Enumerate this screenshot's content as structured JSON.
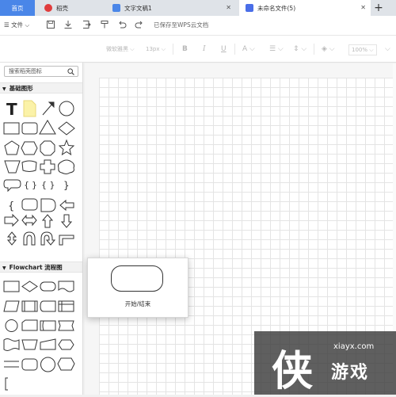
{
  "tabs": [
    {
      "label": "首页",
      "color": "#4a86e8"
    },
    {
      "label": "稻壳",
      "icon": "docer-icon",
      "color": "#e03c3c"
    },
    {
      "label": "文字文稿1",
      "icon": "word-doc-icon",
      "color": "#4a86e8"
    },
    {
      "label": "未命名文件(5)",
      "icon": "flowchart-file-icon",
      "color": "#4a6ee8"
    }
  ],
  "toolbar": {
    "file_menu": "文件",
    "save_status": "已保存至WPS云文档"
  },
  "format_bar": {
    "font_name": "微软雅黑",
    "font_size": "13px",
    "zoom": "100%"
  },
  "sidebar": {
    "search_placeholder": "搜索稻壳图标",
    "basic_section": "基础图形",
    "flowchart_section": "Flowchart 流程图"
  },
  "preview": {
    "caption": "开始/结束"
  },
  "watermark": {
    "site": "xiayx.com",
    "name": "游戏",
    "logo_char": "侠"
  }
}
